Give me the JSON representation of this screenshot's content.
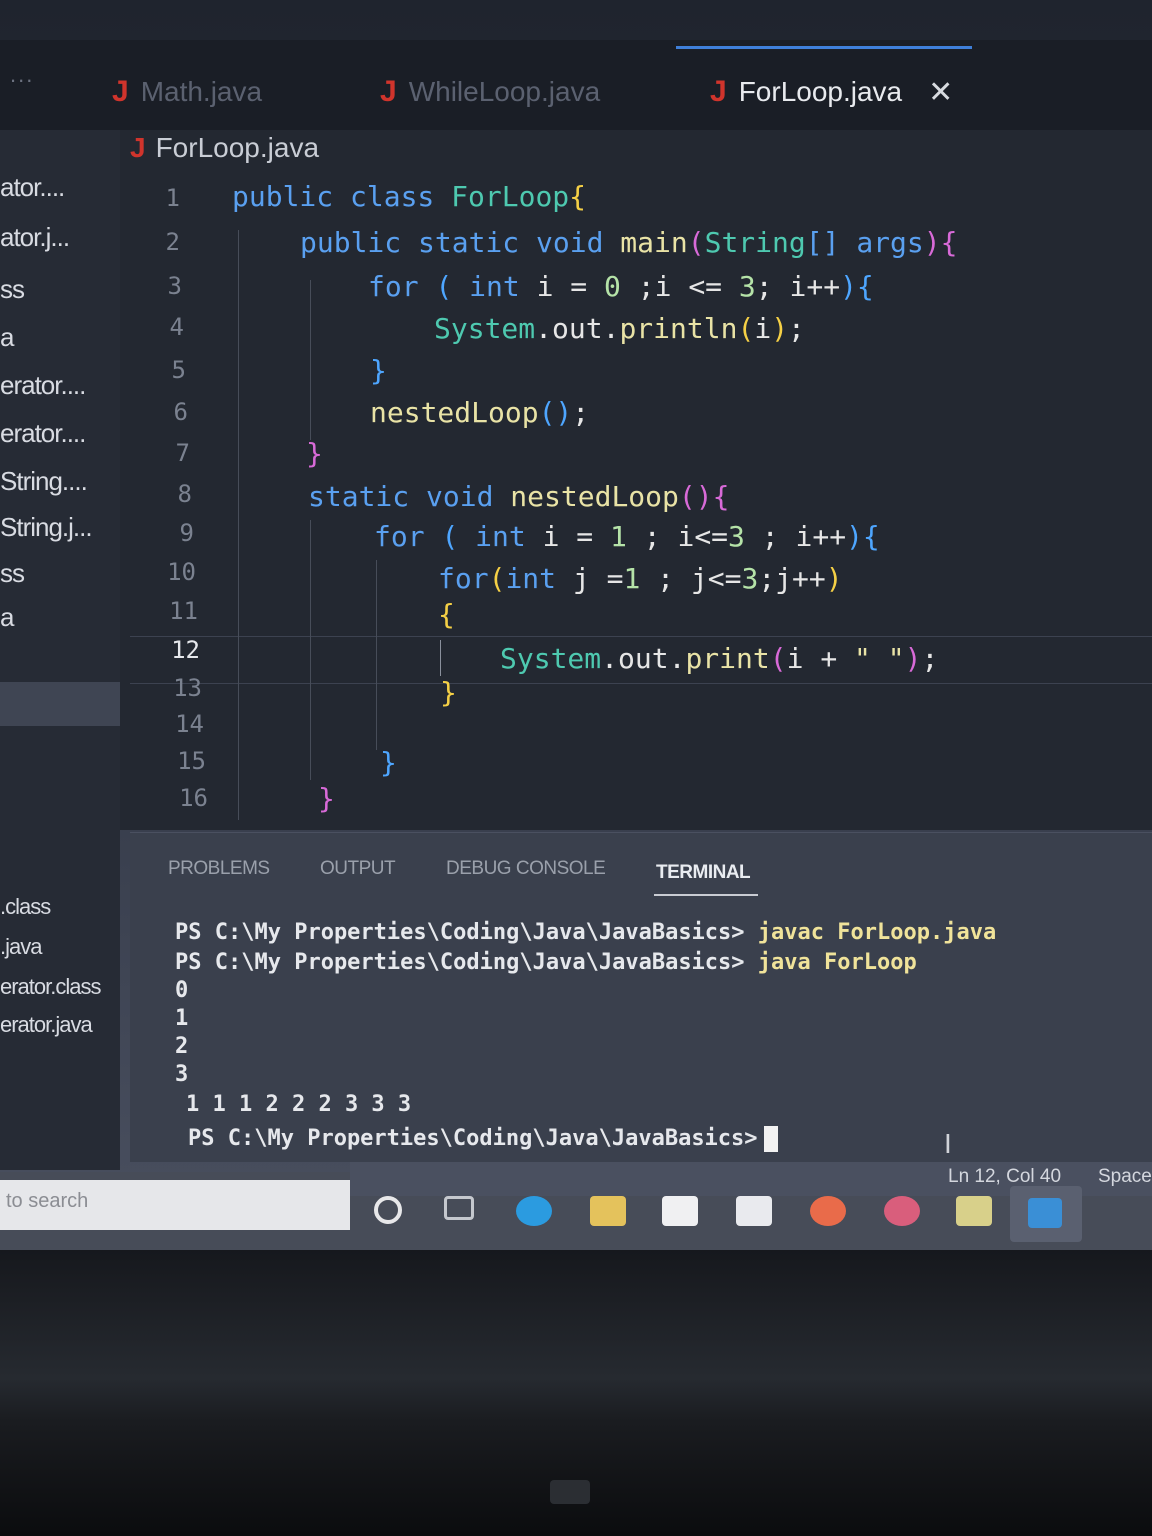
{
  "tabs": [
    {
      "label": "Math.java",
      "active": false
    },
    {
      "label": "WhileLoop.java",
      "active": false
    },
    {
      "label": "ForLoop.java",
      "active": true
    }
  ],
  "tabs_more": "...",
  "close_symbol": "✕",
  "breadcrumb": "ForLoop.java",
  "sidebar": {
    "items": [
      "ator....",
      "ator.j...",
      "ss",
      "a",
      "erator....",
      "erator....",
      "String....",
      "String.j...",
      "ss",
      "a",
      ".class",
      ".java",
      "erator.class",
      "erator.java"
    ]
  },
  "editor": {
    "line_numbers": [
      "1",
      "2",
      "3",
      "4",
      "5",
      "6",
      "7",
      "8",
      "9",
      "10",
      "11",
      "12",
      "13",
      "14",
      "15",
      "16"
    ],
    "current_line": "12"
  },
  "panel": {
    "tabs": [
      "PROBLEMS",
      "OUTPUT",
      "DEBUG CONSOLE",
      "TERMINAL"
    ],
    "active_tab": "TERMINAL",
    "terminal": {
      "prompt": "PS C:\\My Properties\\Coding\\Java\\JavaBasics> ",
      "cmd1": "javac ForLoop.java",
      "cmd2": "java ForLoop",
      "out1": "0",
      "out2": "1",
      "out3": "2",
      "out4": "3",
      "out5": "1 1 1 2 2 2 3 3 3",
      "final_prompt": "PS C:\\My Properties\\Coding\\Java\\JavaBasics>"
    }
  },
  "status": {
    "position": "Ln 12, Col 40",
    "indent": "Space"
  },
  "taskbar": {
    "search_placeholder": "to search"
  },
  "colors": {
    "keyword": "#5aa0f0",
    "bracket_gold": "#f5d046",
    "bracket_purple": "#d86ad8",
    "java_icon": "#d0342c"
  }
}
